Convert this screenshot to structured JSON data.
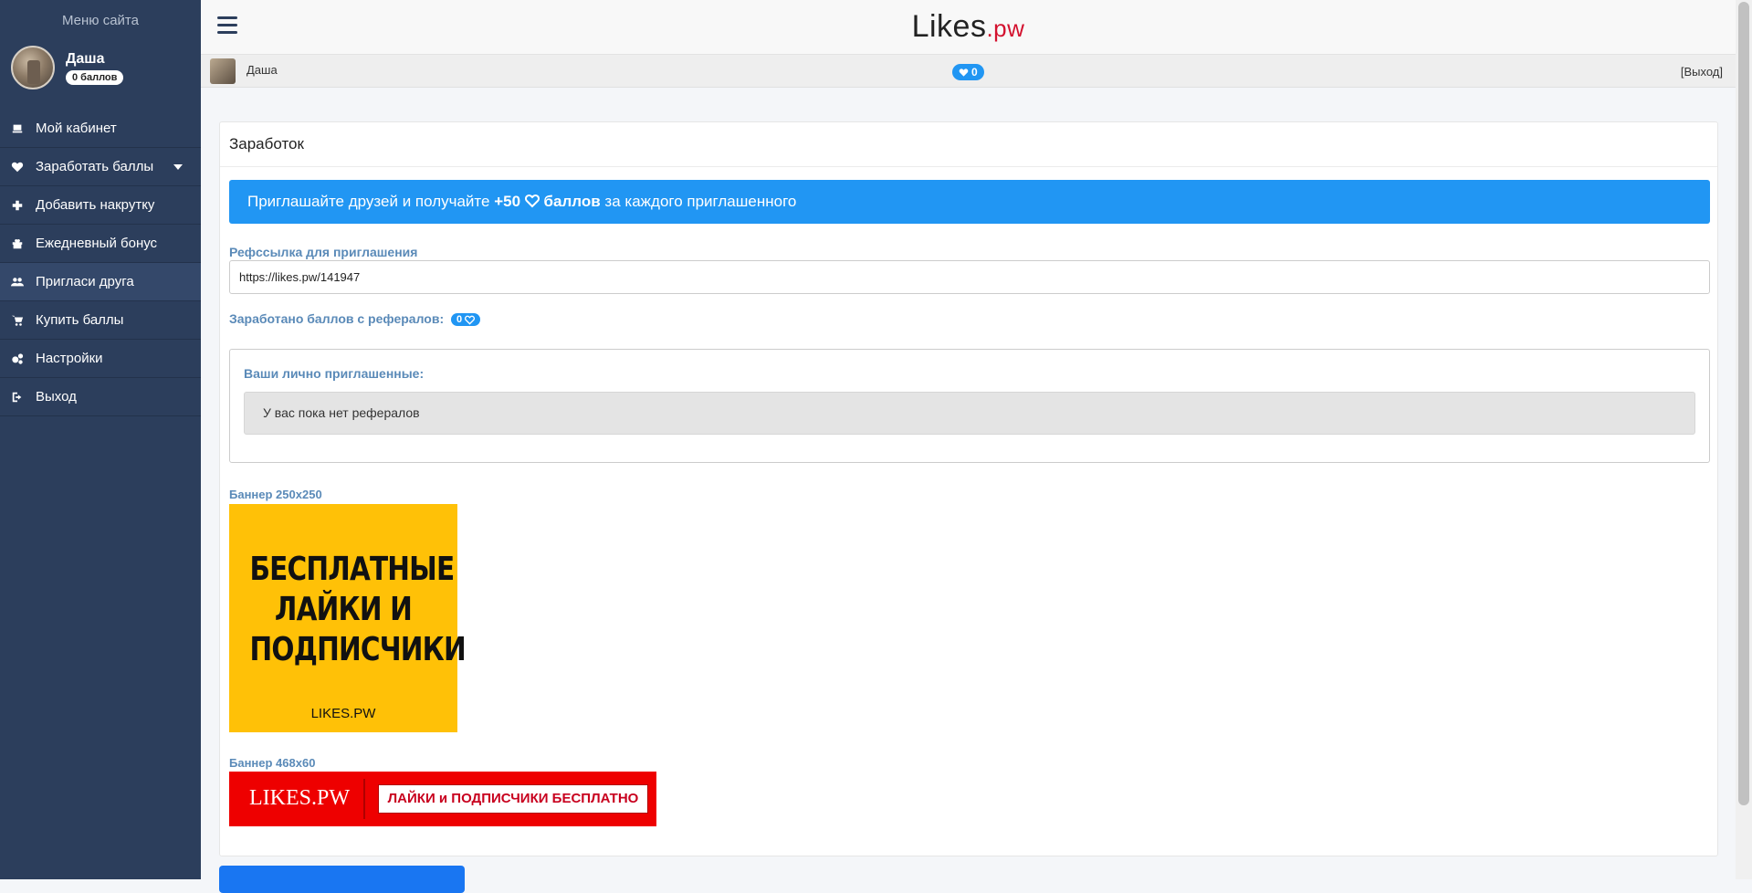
{
  "sidebar": {
    "title": "Меню сайта",
    "user_name": "Даша",
    "points": "0 баллов",
    "items": [
      {
        "label": "Мой кабинет",
        "icon": "laptop-icon"
      },
      {
        "label": "Заработать баллы",
        "icon": "heart-icon"
      },
      {
        "label": "Добавить накрутку",
        "icon": "plus-icon"
      },
      {
        "label": "Ежедневный бонус",
        "icon": "gift-icon"
      },
      {
        "label": "Пригласи друга",
        "icon": "users-icon"
      },
      {
        "label": "Купить баллы",
        "icon": "cart-icon"
      },
      {
        "label": "Настройки",
        "icon": "gears-icon"
      },
      {
        "label": "Выход",
        "icon": "sign-out-icon"
      }
    ]
  },
  "header": {
    "logo_main": "Likes",
    "logo_domain": ".pw",
    "user_name": "Даша",
    "likes_count": "0",
    "logout": "[Выход]"
  },
  "card": {
    "title": "Заработок",
    "invite_prefix": "Приглашайте друзей и получайте ",
    "invite_amount": "+50",
    "invite_unit": "баллов",
    "invite_suffix": " за каждого приглашенного",
    "ref_label": "Рефссылка для приглашения",
    "ref_link": "https://likes.pw/141947",
    "earned_label": "Заработано баллов с рефералов:",
    "earned_value": "0",
    "invited_title": "Ваши лично приглашенные:",
    "empty_text": "У вас пока нет рефералов",
    "banner_250_label": "Баннер 250x250",
    "banner_250_text_1": "БЕСПЛАТНЫЕ",
    "banner_250_text_2": "ЛАЙКИ И",
    "banner_250_text_3": "ПОДПИСЧИКИ",
    "banner_250_site": "LIKES.PW",
    "banner_468_label": "Баннер 468x60",
    "banner_468_logo": "LIKES.PW",
    "banner_468_tagline": "ЛАЙКИ и ПОДПИСЧИКИ БЕСПЛАТНО"
  },
  "colors": {
    "sidebar_bg": "#2c3e5c",
    "accent": "#2196f3",
    "label": "#5a8ab8",
    "banner_yellow": "#ffc107",
    "banner_red": "#ee0000"
  }
}
